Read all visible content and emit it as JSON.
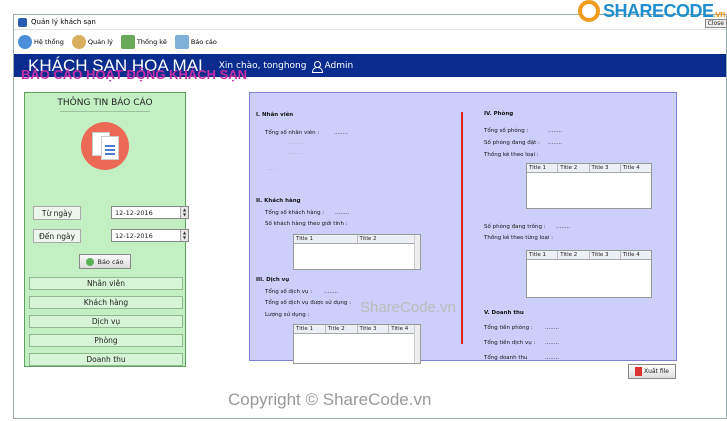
{
  "window": {
    "title": "Quản lý khách sạn",
    "close_label": "Close"
  },
  "logo": {
    "text": "SHARECODE",
    "tld": ".vn"
  },
  "menu": [
    {
      "label": "Hệ thống",
      "icon": "people-icon",
      "color": "#4a8fd8"
    },
    {
      "label": "Quản lý",
      "icon": "manager-icon",
      "color": "#d9b060"
    },
    {
      "label": "Thống kê",
      "icon": "chart-icon",
      "color": "#6aa85a"
    },
    {
      "label": "Báo cáo",
      "icon": "report-icon",
      "color": "#7fb0d8"
    }
  ],
  "banner": {
    "title": "KHÁCH SẠN HOA MAI",
    "greeting": "Xin chào, tonghong",
    "user": "Admin"
  },
  "report_title": "BÁO CÁO HOẠT ĐỘNG KHÁCH SẠN",
  "left": {
    "header": "THÔNG TIN BÁO CÁO",
    "from_label": "Từ ngày",
    "from_value": "12-12-2016",
    "to_label": "Đến ngày",
    "to_value": "12-12-2016",
    "report_button": "Báo cáo",
    "nav": [
      "Nhân viên",
      "Khách hàng",
      "Dịch vụ",
      "Phòng",
      "Doanh thu"
    ]
  },
  "right": {
    "s1": {
      "title": "I. Nhân viên",
      "total": "Tổng số nhân viên :",
      "dots": "........"
    },
    "s2": {
      "title": "II. Khách hàng",
      "total": "Tổng số khách hàng :",
      "by_gender": "Số khách hàng theo giới tính :",
      "cols": [
        "Title 1",
        "Title 2"
      ]
    },
    "s3": {
      "title": "III. Dịch vụ",
      "total": "Tổng số dịch vụ :",
      "used": "Tổng số dịch vụ được sử dụng :",
      "usage": "Lượng sử dụng :",
      "cols": [
        "Title 1",
        "Title 2",
        "Title 3",
        "Title 4"
      ]
    },
    "s4": {
      "title": "IV. Phòng",
      "total": "Tổng số phòng :",
      "booked": "Số phòng đang đặt :",
      "by_type": "Thống kê theo loại :",
      "empty": "Số phòng đang trống :",
      "by_type2": "Thống kê theo từng loại :",
      "cols": [
        "Title 1",
        "Title 2",
        "Title 3",
        "Title 4"
      ]
    },
    "s5": {
      "title": "V. Doanh thu",
      "room": "Tổng tiền phòng :",
      "service": "Tổng tiền dịch vụ :",
      "total": "Tổng doanh thu"
    }
  },
  "export_button": "Xuất file",
  "watermark1": "ShareCode.vn",
  "watermark2": "Copyright © ShareCode.vn"
}
